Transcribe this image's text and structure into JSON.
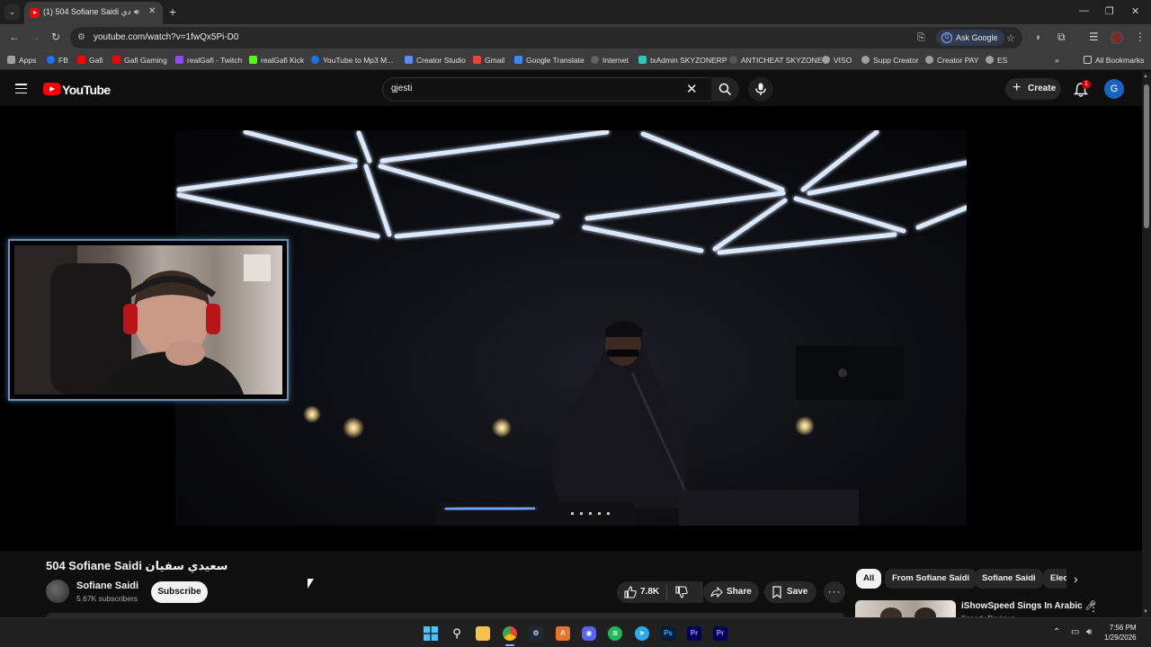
{
  "browser": {
    "tab_title": "(1) 504 Sofiane Saidi سعيدي",
    "url": "youtube.com/watch?v=1fwQx5Pi-D0",
    "ask_google_label": "Ask Google",
    "bookmarks": [
      "Apps",
      "FB",
      "Gafi",
      "Gafi Gaming",
      "realGafi - Twitch",
      "realGafi Kick",
      "YouTube to Mp3 M...",
      "Creator Studio",
      "Gmail",
      "Google Translate",
      "Internet",
      "txAdmin SKYZONERP",
      "ANTICHEAT SKYZONE",
      "VISO",
      "Supp Creator",
      "Creator PAY",
      "ES"
    ],
    "all_bookmarks_label": "All Bookmarks"
  },
  "youtube": {
    "logo_text": "YouTube",
    "search_value": "gjesti",
    "create_label": "Create",
    "notification_count": "1",
    "avatar_letter": "G"
  },
  "video": {
    "title": "504 Sofiane Saidi سعيدي سفيان",
    "channel_name": "Sofiane Saidi",
    "subscribers": "5.67K subscribers",
    "subscribe_label": "Subscribe",
    "likes": "7.8K",
    "share_label": "Share",
    "save_label": "Save"
  },
  "related": {
    "chips": [
      "All",
      "From Sofiane Saidi",
      "Sofiane Saidi",
      "Elec"
    ],
    "first_title": "iShowSpeed Sings In Arabic",
    "first_channel": "Speedy Reviews"
  },
  "taskbar": {
    "time": "7:56 PM",
    "date": "1/29/2026"
  },
  "colors": {
    "youtube_red": "#ff0000",
    "background": "#0f0f0f",
    "neon_light": "#cfe4ff"
  }
}
